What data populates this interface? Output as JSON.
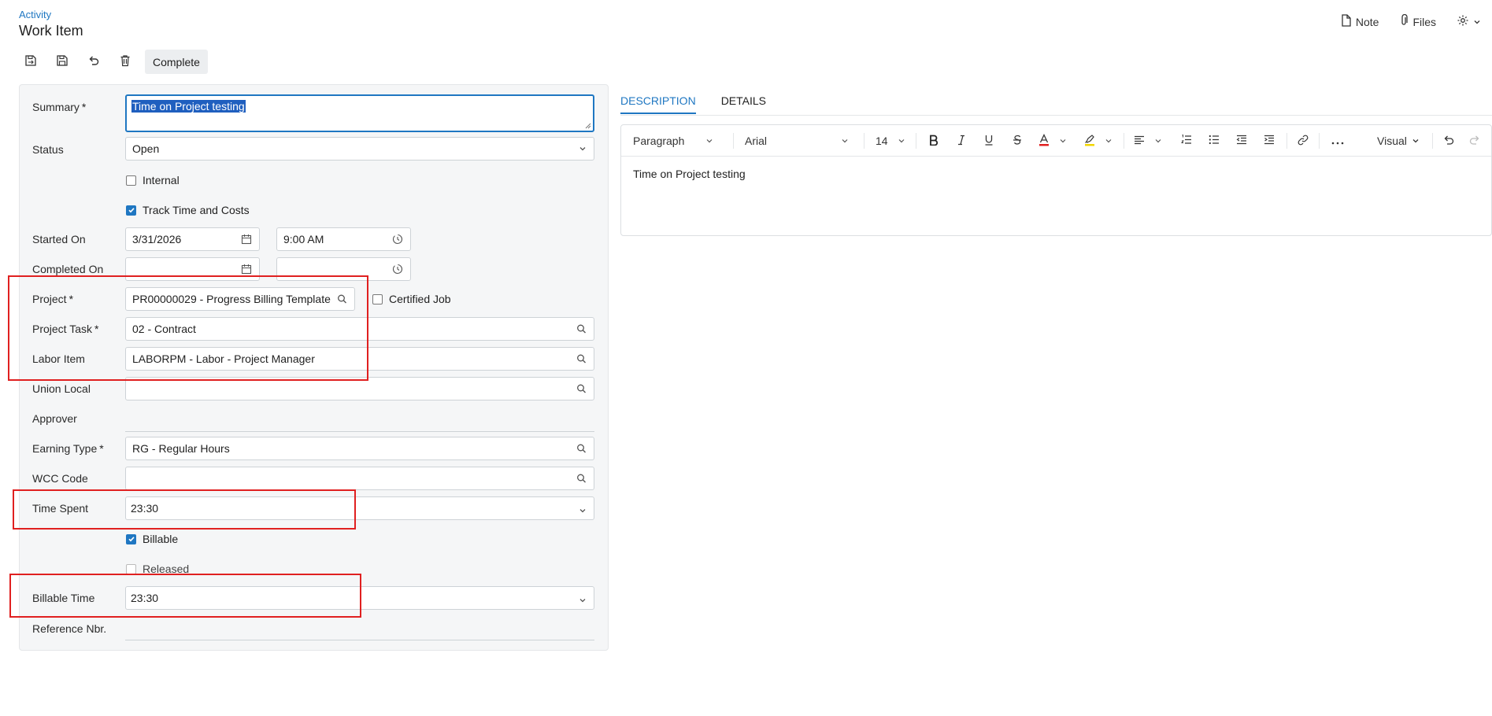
{
  "header": {
    "breadcrumb": "Activity",
    "title": "Work Item",
    "note_label": "Note",
    "files_label": "Files"
  },
  "toolbar": {
    "complete_label": "Complete"
  },
  "form": {
    "summary": {
      "label": "Summary",
      "required": "*",
      "value": "Time on Project testing"
    },
    "status": {
      "label": "Status",
      "value": "Open"
    },
    "internal": {
      "label": "Internal",
      "checked": false
    },
    "track_time": {
      "label": "Track Time and Costs",
      "checked": true
    },
    "started_on": {
      "label": "Started On",
      "date": "3/31/2026",
      "time": "9:00 AM"
    },
    "completed_on": {
      "label": "Completed On",
      "date": "",
      "time": ""
    },
    "project": {
      "label": "Project",
      "required": "*",
      "value": "PR00000029 - Progress Billing Template"
    },
    "certified_job": {
      "label": "Certified Job",
      "checked": false
    },
    "project_task": {
      "label": "Project Task",
      "required": "*",
      "value": "02 - Contract"
    },
    "labor_item": {
      "label": "Labor Item",
      "value": "LABORPM - Labor - Project Manager"
    },
    "union_local": {
      "label": "Union Local",
      "value": ""
    },
    "approver": {
      "label": "Approver",
      "value": ""
    },
    "earning_type": {
      "label": "Earning Type",
      "required": "*",
      "value": "RG - Regular Hours"
    },
    "wcc_code": {
      "label": "WCC Code",
      "value": ""
    },
    "time_spent": {
      "label": "Time Spent",
      "value": "23:30"
    },
    "billable": {
      "label": "Billable",
      "checked": true
    },
    "released": {
      "label": "Released",
      "checked": false
    },
    "billable_time": {
      "label": "Billable Time",
      "value": "23:30"
    },
    "reference_nbr": {
      "label": "Reference Nbr.",
      "value": ""
    }
  },
  "tabs": [
    {
      "label": "DESCRIPTION",
      "active": true
    },
    {
      "label": "DETAILS",
      "active": false
    }
  ],
  "editor": {
    "paragraph": "Paragraph",
    "font": "Arial",
    "size": "14",
    "mode": "Visual",
    "content": "Time on Project testing"
  },
  "colors": {
    "accent": "#1f77c2",
    "highlight_box": "#e02020",
    "font_color_bar": "#e02020",
    "highlight_color_bar": "#f2d600"
  }
}
